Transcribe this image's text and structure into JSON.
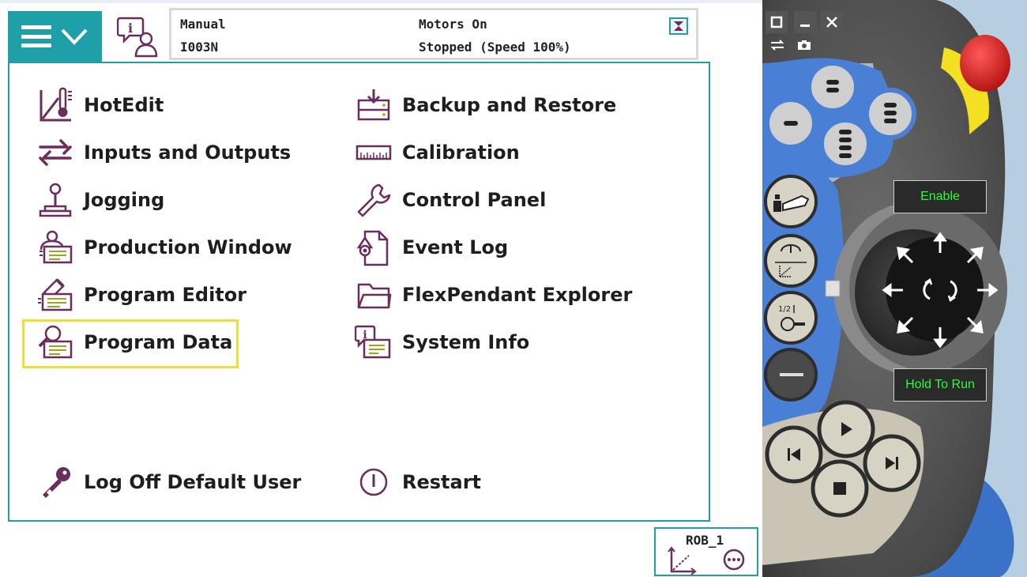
{
  "header": {
    "mode": "Manual",
    "system_name": "I003N",
    "motors_state": "Motors On",
    "run_state": "Stopped (Speed 100%)"
  },
  "menu": {
    "left": [
      {
        "label": "HotEdit",
        "icon": "hotedit-icon"
      },
      {
        "label": "Inputs and Outputs",
        "icon": "io-arrows-icon"
      },
      {
        "label": "Jogging",
        "icon": "joystick-icon"
      },
      {
        "label": "Production Window",
        "icon": "production-window-icon"
      },
      {
        "label": "Program Editor",
        "icon": "program-editor-icon"
      },
      {
        "label": "Program Data",
        "icon": "program-data-icon"
      }
    ],
    "right": [
      {
        "label": "Backup and Restore",
        "icon": "backup-icon"
      },
      {
        "label": "Calibration",
        "icon": "ruler-icon"
      },
      {
        "label": "Control Panel",
        "icon": "wrench-icon"
      },
      {
        "label": "Event Log",
        "icon": "event-log-icon"
      },
      {
        "label": "FlexPendant Explorer",
        "icon": "folder-icon"
      },
      {
        "label": "System Info",
        "icon": "system-info-icon"
      }
    ],
    "bottom": {
      "log_off": "Log Off Default User",
      "restart": "Restart"
    },
    "selected": "Program Data"
  },
  "quickset": {
    "mechanical_unit": "ROB_1"
  },
  "pendant": {
    "enable_label": "Enable",
    "hold_to_run_label": "Hold To Run"
  },
  "colors": {
    "accent": "#1f9fa8",
    "icon_purple": "#6b2d5c",
    "highlight": "#f2dc3a",
    "pendant_blue": "#4a7fd6",
    "emergency_red": "#e01b1b",
    "guard_yellow": "#f3e022",
    "led_green": "#2bff3a"
  }
}
